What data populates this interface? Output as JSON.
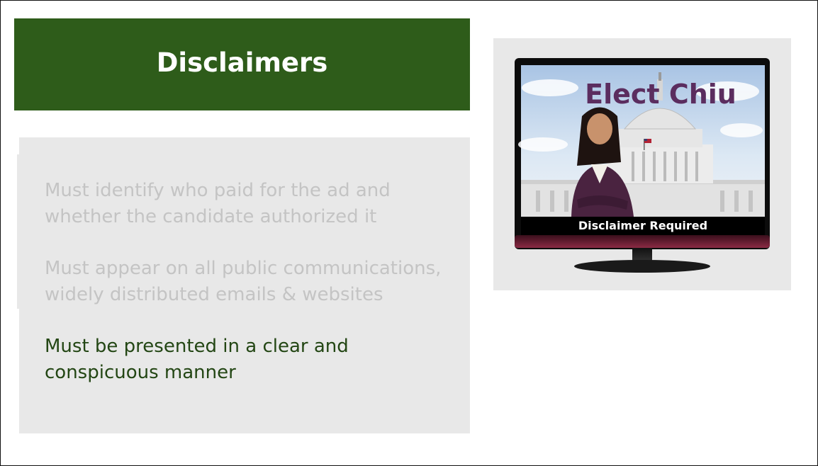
{
  "slide": {
    "title": "Disclaimers",
    "bullets": [
      "Must identify who paid for the ad and whether the candidate authorized it",
      "Must appear on all public communications, widely distributed emails & websites",
      "Must be presented in a clear and conspicuous manner"
    ]
  },
  "tv_image": {
    "headline": "Elect Chiu",
    "caption": "Disclaimer Required"
  },
  "colors": {
    "title_bar": "#2e5c1a",
    "active_text": "#234614",
    "inactive_text": "#c4c4c4",
    "panel_bg": "#e8e8e8",
    "headline": "#5b2d5f"
  }
}
